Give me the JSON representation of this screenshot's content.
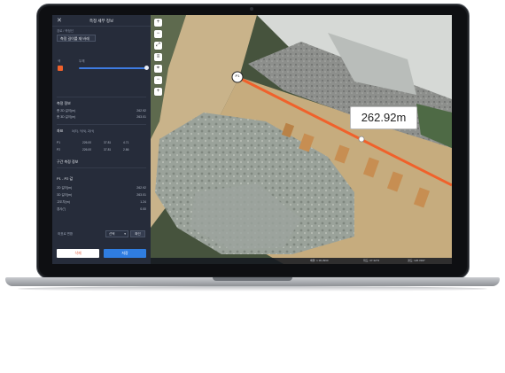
{
  "panel": {
    "title": "측정 세부 정보",
    "breadcrumb": "경로 / 측정선",
    "name_value": "측정 길이를 재 바레",
    "color_label": "색",
    "thickness_label": "두께",
    "section_measure": "측정 정보",
    "measure_rows": [
      {
        "label": "총 2D 길이(m)",
        "value": "262.92"
      },
      {
        "label": "총 3D 길이(m)",
        "value": "263.01"
      }
    ],
    "section_coord": "좌표",
    "coord_meta": "X(E), Y(N), Z(H)",
    "coord_rows": [
      {
        "label": "P1",
        "x": "226.00",
        "y": "37.81",
        "z": "4.71"
      },
      {
        "label": "P2",
        "x": "226.00",
        "y": "37.81",
        "z": "2.86"
      }
    ],
    "section_segments": "구간 측정 정보",
    "segment_title": "P1 - P2 값",
    "segment_rows": [
      {
        "label": "2D 길이(m)",
        "value": "262.92"
      },
      {
        "label": "3D 길이(m)",
        "value": "263.01"
      },
      {
        "label": "고도차(m)",
        "value": "1.24"
      },
      {
        "label": "경사(°)",
        "value": "0.00"
      }
    ],
    "export_label": "좌표로 변환",
    "select_value": "선택",
    "apply_label": "확인",
    "cancel_label": "삭제",
    "save_label": "저장"
  },
  "map": {
    "distance_label": "262.92m",
    "point_label": "P1",
    "tools": [
      "plus-icon",
      "minus-icon",
      "expand-icon",
      "layers-icon",
      "location-icon",
      "minus-icon",
      "plus-icon"
    ],
    "status": [
      "배율: 1:36,3960",
      "위도: 37.3273",
      "경도: 126.3947"
    ]
  },
  "colors": {
    "accent": "#2f7de1",
    "measure_line": "#f0612b",
    "panel_bg": "#262c3a"
  }
}
